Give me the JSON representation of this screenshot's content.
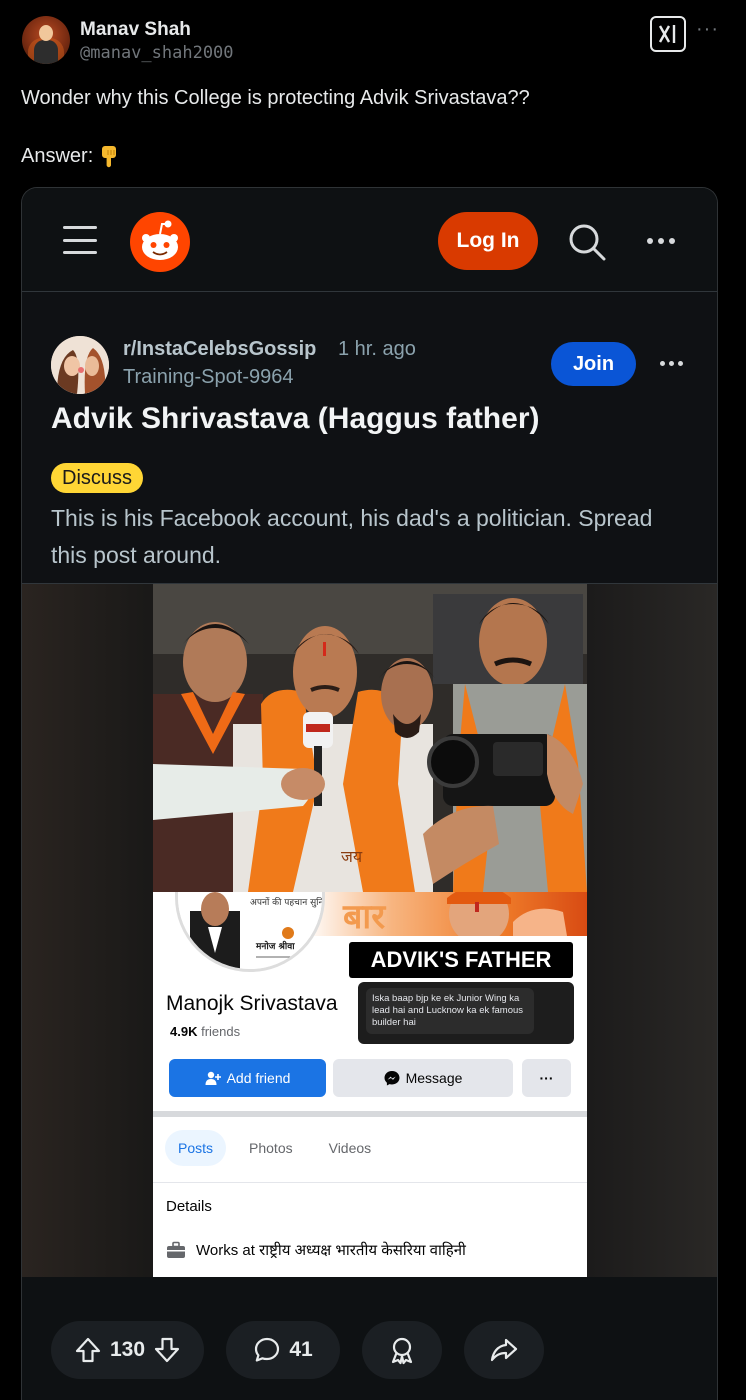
{
  "tweet": {
    "author_name": "Manav Shah",
    "author_handle": "@manav_shah2000",
    "grok_icon": "grok-icon",
    "more_icon": "more-icon",
    "text_line1": "Wonder why this College is protecting Advik Srivastava??",
    "text_line2": "Answer:",
    "answer_emoji": "pointing-down-icon"
  },
  "reddit": {
    "login_label": "Log In",
    "subreddit": "r/InstaCelebsGossip",
    "time_ago": "1 hr. ago",
    "username": "Training-Spot-9964",
    "join_label": "Join",
    "post_title": "Advik Shrivastava (Haggus father)",
    "flair": "Discuss",
    "post_body": "This is his Facebook account, his dad's a politician. Spread this post around.",
    "upvotes": "130",
    "comments": "41"
  },
  "facebook": {
    "pic_caption_top": "अपनों की पहचान सुनिश्चित होती है...",
    "pic_caption_name": "मनोज श्रीवा",
    "banner_text": "बार",
    "overlay_label": "ADVIK'S FATHER",
    "overlay_note": "Iska baap bjp ke ek Junior Wing ka lead hai and Lucknow ka ek famous builder hai",
    "profile_name": "Manojk Srivastava",
    "friends_count": "4.9K",
    "friends_label": "friends",
    "add_friend_label": "Add friend",
    "message_label": "Message",
    "more_label": "···",
    "tabs": [
      "Posts",
      "Photos",
      "Videos"
    ],
    "details_label": "Details",
    "works_at": "Works at राष्ट्रीय अध्यक्ष भारतीय केसरिया वाहिनी",
    "photo_scarf_text": "जय"
  },
  "colors": {
    "reddit_orange": "#d93a00",
    "join_blue": "#0a55d6",
    "flair_yellow": "#ffd635",
    "fb_blue": "#1b74e4"
  }
}
